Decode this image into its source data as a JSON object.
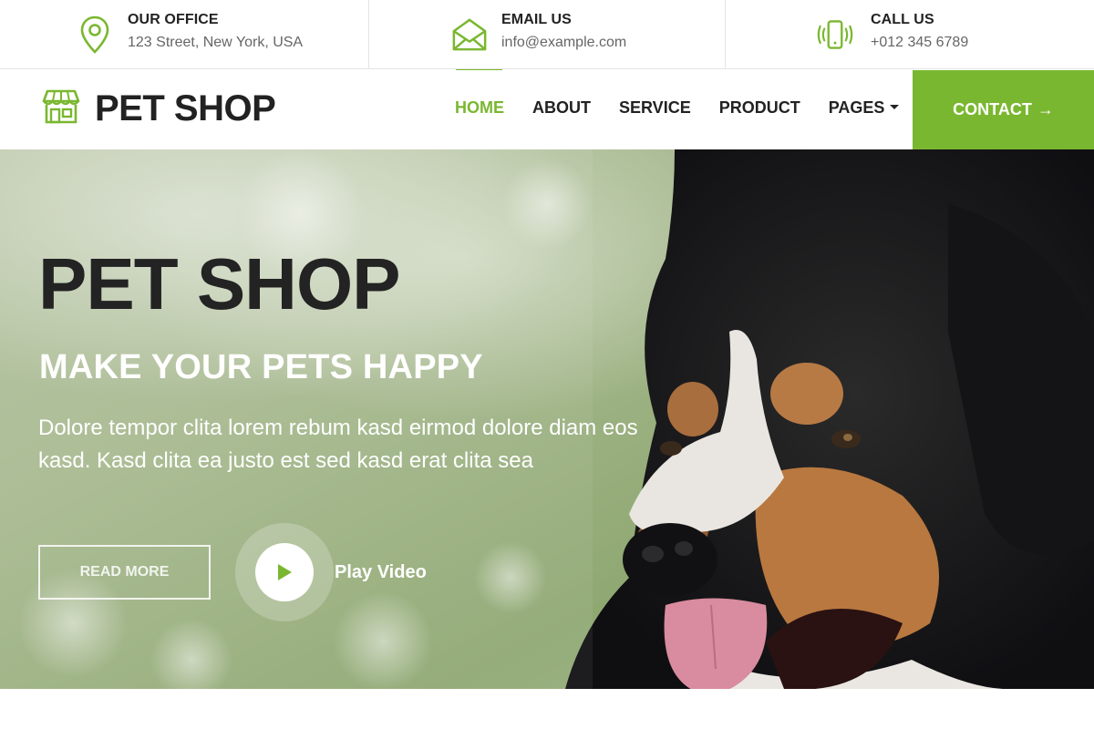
{
  "topbar": {
    "office": {
      "label": "OUR OFFICE",
      "value": "123 Street, New York, USA",
      "icon": "map-pin-icon"
    },
    "email": {
      "label": "EMAIL US",
      "value": "info@example.com",
      "icon": "envelope-icon"
    },
    "call": {
      "label": "CALL US",
      "value": "+012 345 6789",
      "icon": "phone-vibrate-icon"
    }
  },
  "brand": {
    "name": "PET SHOP",
    "icon": "storefront-icon"
  },
  "nav": {
    "items": [
      {
        "label": "HOME",
        "active": true
      },
      {
        "label": "ABOUT",
        "active": false
      },
      {
        "label": "SERVICE",
        "active": false
      },
      {
        "label": "PRODUCT",
        "active": false
      },
      {
        "label": "PAGES",
        "active": false,
        "dropdown": true
      }
    ],
    "contact": {
      "label": "CONTACT",
      "icon": "arrow-right-icon"
    }
  },
  "hero": {
    "title": "PET SHOP",
    "subtitle": "MAKE YOUR PETS HAPPY",
    "description": "Dolore tempor clita lorem rebum kasd eirmod dolore diam eos kasd. Kasd clita ea justo est sed kasd erat clita sea",
    "read_more": "READ MORE",
    "play_label": "Play Video",
    "play_icon": "play-icon"
  },
  "colors": {
    "accent": "#7ab730",
    "dark": "#222222",
    "muted": "#666666"
  }
}
